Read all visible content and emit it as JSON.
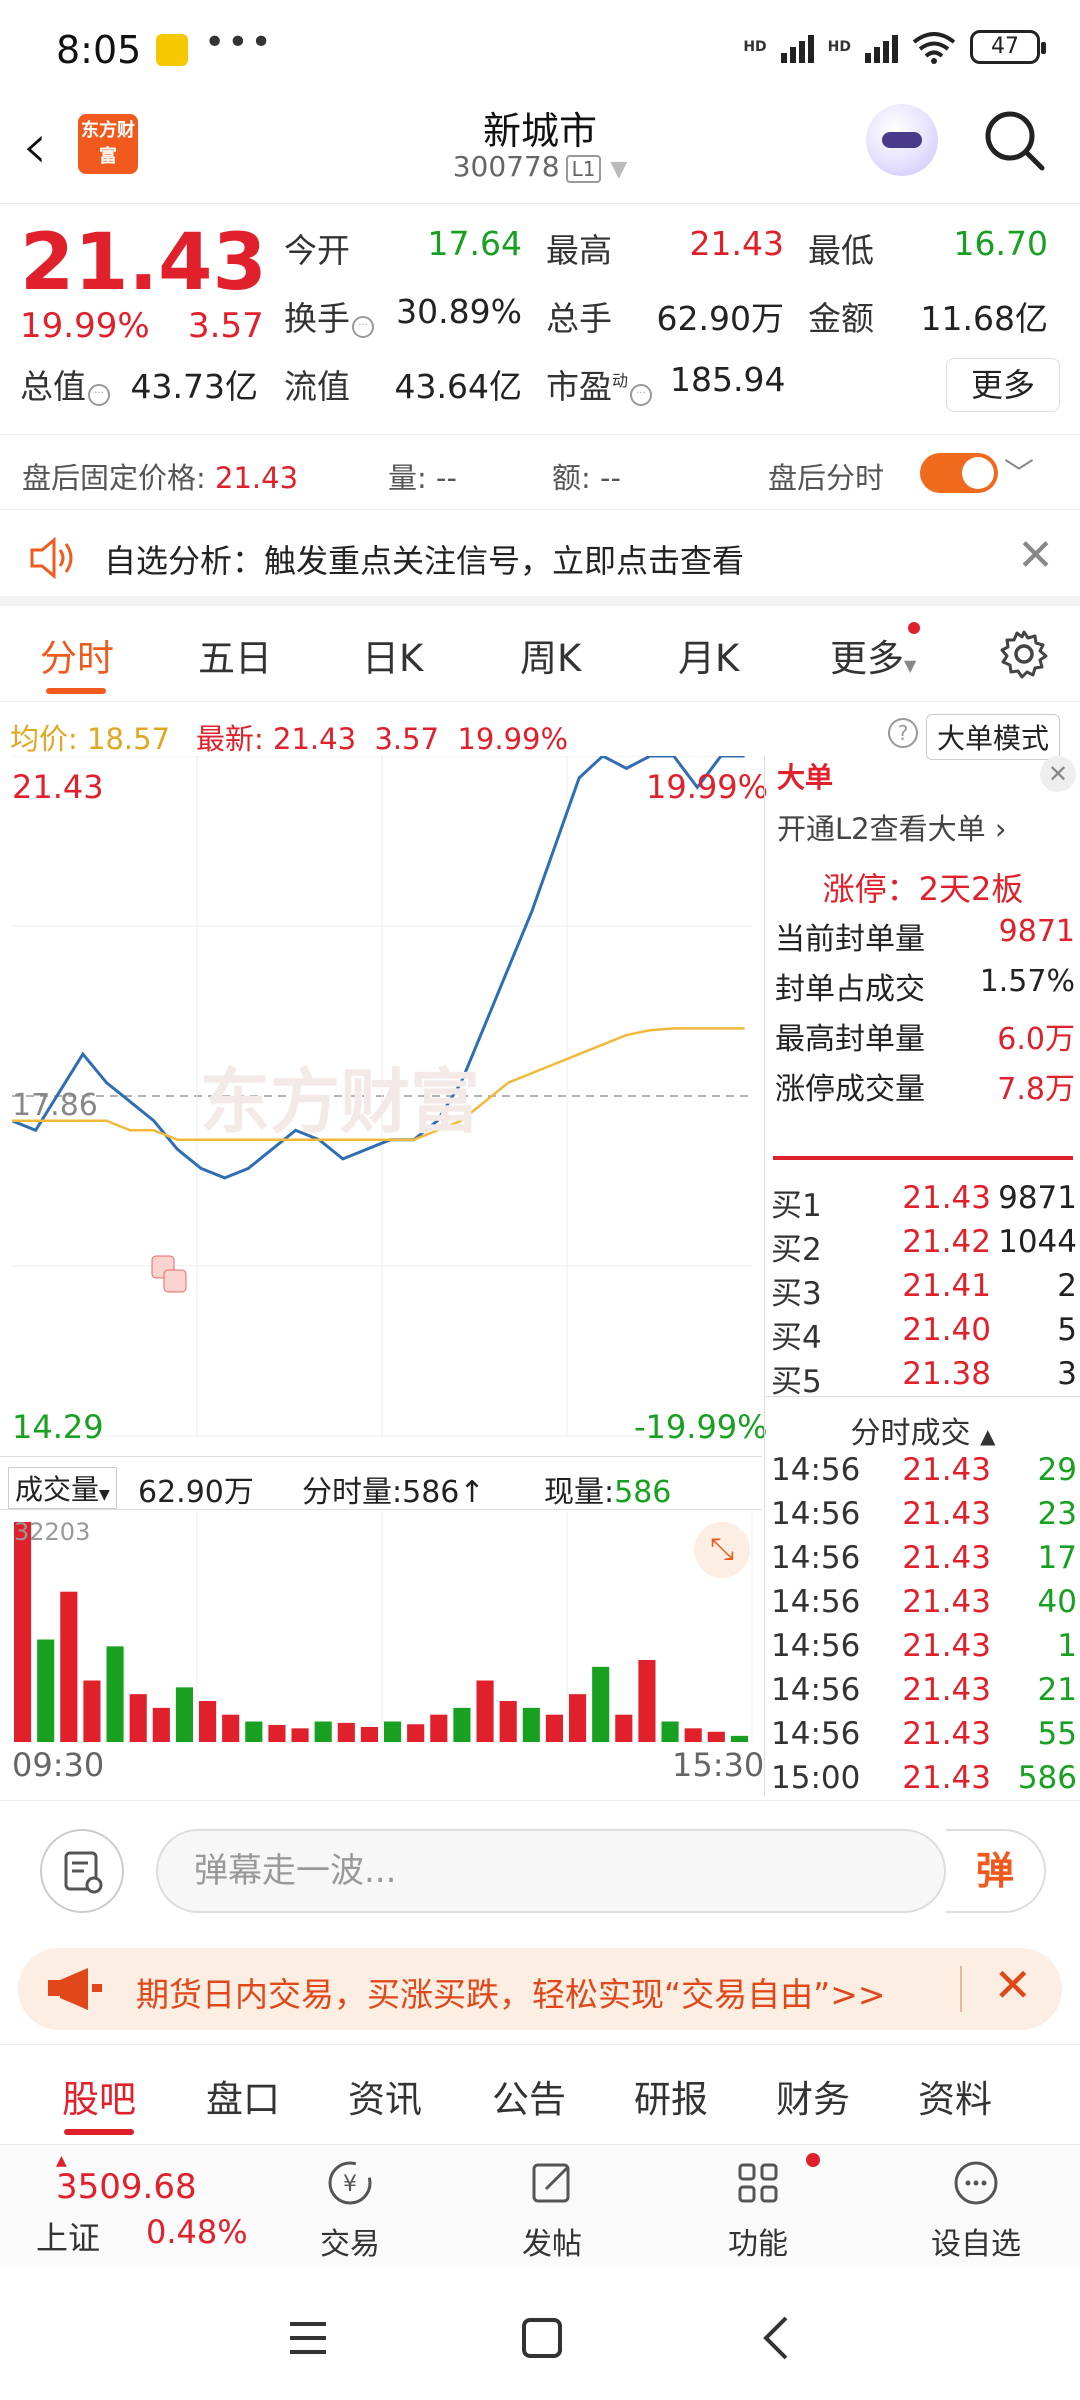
{
  "status_bar": {
    "time": "8:05",
    "dots": "•••",
    "hd1": "HD",
    "hd2": "HD",
    "battery": "47"
  },
  "header": {
    "name": "新城市",
    "code": "300778",
    "level": "L1",
    "logo_text": "东方财富"
  },
  "quote": {
    "price": "21.43",
    "change_pct": "19.99%",
    "change_val": "3.57",
    "open_label": "今开",
    "open": "17.64",
    "high_label": "最高",
    "high": "21.43",
    "low_label": "最低",
    "low": "16.70",
    "turnover_label": "换手",
    "turnover": "30.89%",
    "volume_label": "总手",
    "volume": "62.90万",
    "amount_label": "金额",
    "amount": "11.68亿",
    "mcap_label": "总值",
    "mcap": "43.73亿",
    "float_label": "流值",
    "float_mcap": "43.64亿",
    "pe_label": "市盈",
    "pe_sup": "动",
    "pe": "185.94",
    "more": "更多"
  },
  "after_hours": {
    "price_label": "盘后固定价格:",
    "price": "21.43",
    "vol_label": "量:",
    "vol": "--",
    "amt_label": "额:",
    "amt": "--",
    "toggle_label": "盘后分时"
  },
  "alert": {
    "text": "自选分析：触发重点关注信号，立即点击查看"
  },
  "chart_tabs": [
    "分时",
    "五日",
    "日K",
    "周K",
    "月K",
    "更多"
  ],
  "avg_row": {
    "avg_label": "均价:",
    "avg": "18.57",
    "latest_label": "最新:",
    "latest": "21.43",
    "chg": "3.57",
    "pct": "19.99%",
    "big_order": "大单模式"
  },
  "chart": {
    "top_price": "21.43",
    "top_pct": "19.99%",
    "mid_price": "17.86",
    "bottom_price": "14.29",
    "bottom_pct": "-19.99%",
    "start_time": "09:30",
    "end_time": "15:30",
    "marker": "B",
    "watermark": "东方财富",
    "vol_max": "32203",
    "vol_label": "成交量",
    "vol_total": "62.90万",
    "tick_vol_label": "分时量:",
    "tick_vol": "586",
    "cur_vol_label": "现量:",
    "cur_vol": "586"
  },
  "chart_data": {
    "type": "line",
    "title": "",
    "ylim": [
      14.29,
      21.43
    ],
    "series": [
      {
        "values": [
          17.6,
          17.5,
          17.9,
          18.3,
          18.0,
          17.8,
          17.6,
          17.3,
          17.1,
          17.0,
          17.1,
          17.3,
          17.5,
          17.4,
          17.2,
          17.3,
          17.4,
          17.4,
          17.6,
          18.0,
          18.6,
          19.2,
          19.8,
          20.5,
          21.2,
          21.43,
          21.3,
          21.43,
          21.43,
          21.1,
          21.43,
          21.43
        ]
      },
      {
        "values": [
          17.6,
          17.6,
          17.6,
          17.6,
          17.6,
          17.5,
          17.5,
          17.4,
          17.4,
          17.4,
          17.4,
          17.4,
          17.4,
          17.4,
          17.4,
          17.4,
          17.4,
          17.4,
          17.5,
          17.6,
          17.8,
          18.0,
          18.1,
          18.2,
          18.3,
          18.4,
          18.5,
          18.55,
          18.57,
          18.57,
          18.57,
          18.57
        ]
      }
    ],
    "volume": [
      32203,
      15000,
      22000,
      9000,
      14000,
      7000,
      5000,
      8000,
      6000,
      4000,
      3000,
      2500,
      2000,
      3000,
      2800,
      2200,
      3000,
      2600,
      4000,
      5000,
      9000,
      6000,
      5000,
      4000,
      7000,
      11000,
      4000,
      12000,
      3000,
      2000,
      1500,
      900
    ]
  },
  "panel": {
    "header_text": "大单",
    "open_l2": "开通L2查看大单 ›",
    "limit_up": "涨停：2天2板",
    "stats": [
      {
        "label": "当前封单量",
        "value": "9871"
      },
      {
        "label": "封单占成交",
        "value": "1.57%"
      },
      {
        "label": "最高封单量",
        "value": "6.0万"
      },
      {
        "label": "涨停成交量",
        "value": "7.8万"
      }
    ],
    "bids": [
      {
        "label": "买1",
        "price": "21.43",
        "vol": "9871"
      },
      {
        "label": "买2",
        "price": "21.42",
        "vol": "1044"
      },
      {
        "label": "买3",
        "price": "21.41",
        "vol": "2"
      },
      {
        "label": "买4",
        "price": "21.40",
        "vol": "5"
      },
      {
        "label": "买5",
        "price": "21.38",
        "vol": "3"
      }
    ],
    "ticks_title": "分时成交",
    "ticks": [
      {
        "time": "14:56",
        "price": "21.43",
        "vol": "29"
      },
      {
        "time": "14:56",
        "price": "21.43",
        "vol": "23"
      },
      {
        "time": "14:56",
        "price": "21.43",
        "vol": "17"
      },
      {
        "time": "14:56",
        "price": "21.43",
        "vol": "40"
      },
      {
        "time": "14:56",
        "price": "21.43",
        "vol": "1"
      },
      {
        "time": "14:56",
        "price": "21.43",
        "vol": "21"
      },
      {
        "time": "14:56",
        "price": "21.43",
        "vol": "55"
      },
      {
        "time": "15:00",
        "price": "21.43",
        "vol": "586"
      }
    ]
  },
  "danmaku": {
    "placeholder": "弹幕走一波...",
    "button": "弹"
  },
  "promo": {
    "text": "期货日内交易，买涨买跌，轻松实现“交易自由”>>"
  },
  "bottom_tabs": [
    "股吧",
    "盘口",
    "资讯",
    "公告",
    "研报",
    "财务",
    "资料"
  ],
  "footer": {
    "index_value": "3509.68",
    "index_name": "上证",
    "index_pct": "0.48%",
    "trade": "交易",
    "post": "发帖",
    "func": "功能",
    "add": "设自选"
  },
  "colors": {
    "up": "#e0202a",
    "down": "#18a020",
    "accent": "#f05a1e",
    "price_line": "#2f6db5",
    "avg_line": "#f0b93a"
  }
}
